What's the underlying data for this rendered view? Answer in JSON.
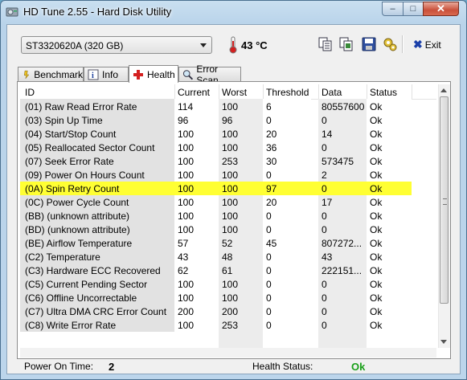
{
  "window": {
    "title": "HD Tune 2.55 - Hard Disk Utility"
  },
  "toolbar": {
    "drive": "ST3320620A (320 GB)",
    "temperature": "43 °C",
    "exit_label": "Exit",
    "icons": [
      "copy-info-icon",
      "copy-screen-icon",
      "save-icon",
      "options-icon"
    ]
  },
  "tabs": [
    {
      "label": "Benchmark",
      "icon": "benchmark-icon"
    },
    {
      "label": "Info",
      "icon": "info-icon"
    },
    {
      "label": "Health",
      "icon": "health-icon",
      "active": true
    },
    {
      "label": "Error Scan",
      "icon": "error-scan-icon"
    }
  ],
  "table": {
    "columns": [
      "ID",
      "Current",
      "Worst",
      "Threshold",
      "Data",
      "Status"
    ],
    "rows": [
      [
        "(01) Raw Read Error Rate",
        "114",
        "100",
        "6",
        "80557600",
        "Ok"
      ],
      [
        "(03) Spin Up Time",
        "96",
        "96",
        "0",
        "0",
        "Ok"
      ],
      [
        "(04) Start/Stop Count",
        "100",
        "100",
        "20",
        "14",
        "Ok"
      ],
      [
        "(05) Reallocated Sector Count",
        "100",
        "100",
        "36",
        "0",
        "Ok"
      ],
      [
        "(07) Seek Error Rate",
        "100",
        "253",
        "30",
        "573475",
        "Ok"
      ],
      [
        "(09) Power On Hours Count",
        "100",
        "100",
        "0",
        "2",
        "Ok"
      ],
      [
        "(0A) Spin Retry Count",
        "100",
        "100",
        "97",
        "0",
        "Ok"
      ],
      [
        "(0C) Power Cycle Count",
        "100",
        "100",
        "20",
        "17",
        "Ok"
      ],
      [
        "(BB) (unknown attribute)",
        "100",
        "100",
        "0",
        "0",
        "Ok"
      ],
      [
        "(BD) (unknown attribute)",
        "100",
        "100",
        "0",
        "0",
        "Ok"
      ],
      [
        "(BE) Airflow Temperature",
        "57",
        "52",
        "45",
        "807272...",
        "Ok"
      ],
      [
        "(C2) Temperature",
        "43",
        "48",
        "0",
        "43",
        "Ok"
      ],
      [
        "(C3) Hardware ECC Recovered",
        "62",
        "61",
        "0",
        "222151...",
        "Ok"
      ],
      [
        "(C5) Current Pending Sector",
        "100",
        "100",
        "0",
        "0",
        "Ok"
      ],
      [
        "(C6) Offline Uncorrectable",
        "100",
        "100",
        "0",
        "0",
        "Ok"
      ],
      [
        "(C7) Ultra DMA CRC Error Count",
        "200",
        "200",
        "0",
        "0",
        "Ok"
      ],
      [
        "(C8) Write Error Rate",
        "100",
        "253",
        "0",
        "0",
        "Ok"
      ]
    ],
    "highlighted_row": 6,
    "highlight_color": "#ffff33"
  },
  "footer": {
    "power_on_label": "Power On Time:",
    "power_on_value": "2",
    "health_label": "Health Status:",
    "health_value": "Ok",
    "health_color": "#19a019"
  }
}
